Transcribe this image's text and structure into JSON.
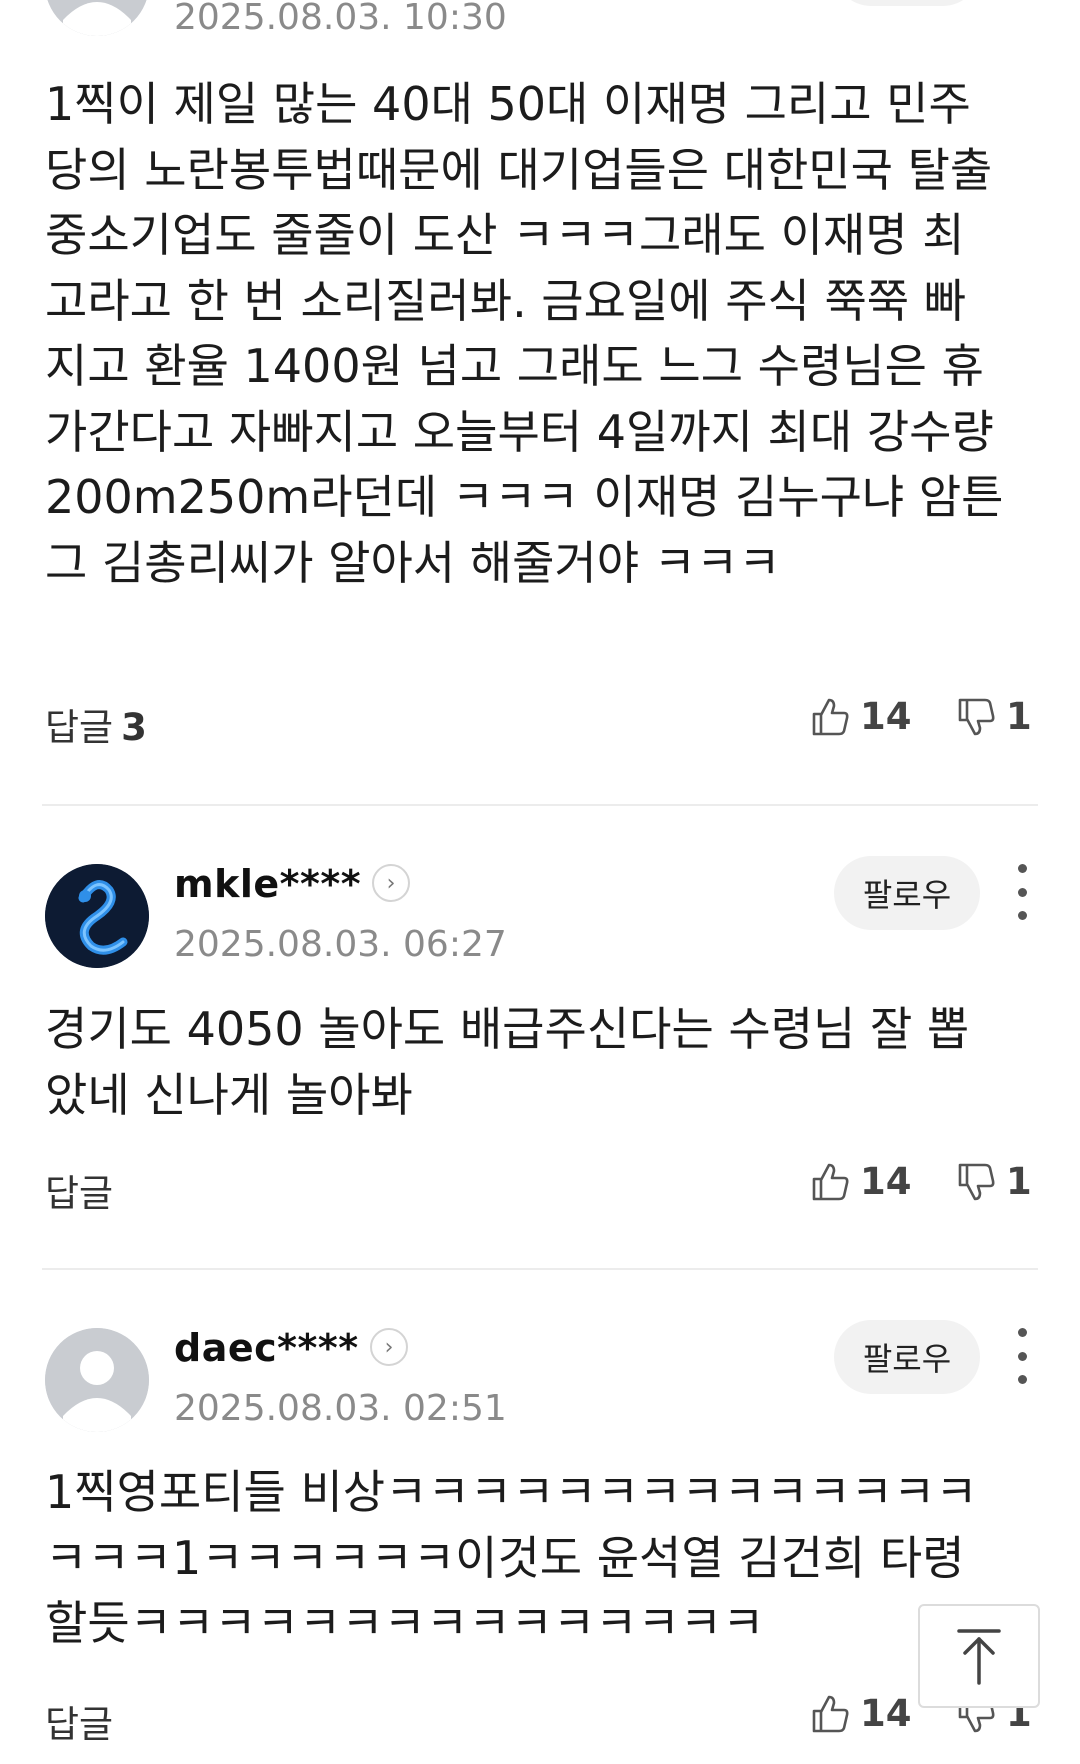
{
  "comments": [
    {
      "author": "",
      "date": "2025.08.03. 10:30",
      "body": "1찍이 제일 많는 40대 50대 이재명 그리고 민주당의 노란봉투법때문에 대기업들은 대한민국 탈출 중소기업도 줄줄이 도산 ㅋㅋㅋ그래도 이재명 최고라고 한 번 소리질러봐. 금요일에 주식 쭉쭉 빠지고 환율 1400원 넘고 그래도 느그 수령님은 휴가간다고 자빠지고 오늘부터 4일까지 최대 강수량 200m250m라던데 ㅋㅋㅋ 이재명 김누구냐 암튼 그 김총리씨가 알아서 해줄거야 ㅋㅋㅋ",
      "reply_label": "답글",
      "reply_count": "3",
      "likes": "14",
      "dislikes": "1"
    },
    {
      "author": "mkle****",
      "date": "2025.08.03. 06:27",
      "follow_label": "팔로우",
      "body": "경기도 4050 놀아도 배급주신다는 수령님 잘 뽑았네 신나게 놀아봐",
      "reply_label": "답글",
      "likes": "14",
      "dislikes": "1"
    },
    {
      "author": "daec****",
      "date": "2025.08.03. 02:51",
      "follow_label": "팔로우",
      "body": "1찍영포티들 비상ㅋㅋㅋㅋㅋㅋㅋㅋㅋㅋㅋㅋㅋㅋㅋㅋㅋ1ㅋㅋㅋㅋㅋㅋ이것도 윤석열 김건희 타령할듯ㅋㅋㅋㅋㅋㅋㅋㅋㅋㅋㅋㅋㅋㅋㅋ",
      "reply_label": "답글",
      "likes": "14",
      "dislikes": "1"
    }
  ],
  "icons": {
    "like": "thumbs-up-icon",
    "dislike": "thumbs-down-icon",
    "more": "more-vertical-icon",
    "profile": "chevron-right-icon",
    "scroll_top": "arrow-up-icon"
  }
}
